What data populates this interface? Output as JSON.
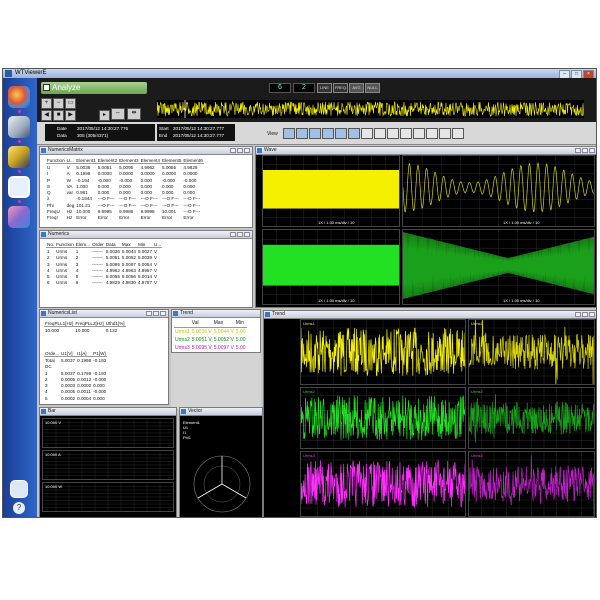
{
  "window": {
    "title": "WTViewerE"
  },
  "toolbar": {
    "analyze_label": "Analyze",
    "indicators": [
      "6",
      "2"
    ],
    "mode_labels": [
      "LINE",
      "FREQ",
      "AVG",
      "NULL"
    ]
  },
  "info": {
    "date_label": "Date",
    "data_label": "Data",
    "date_value": "2017/05/12 14:30:27.776",
    "data_value": "305 (305/4371)",
    "start_label": "Start",
    "end_label": "End",
    "start_value": "2017/05/12 14:30:27.777",
    "end_value": "2017/05/12 14:30:27.777",
    "view_label": "View"
  },
  "numerics_matrix": {
    "title": "NumericsMatrix",
    "headers": [
      "Function",
      "U...",
      "Element1",
      "Element2",
      "Element3",
      "Element4",
      "Element5",
      "Element6"
    ],
    "rows": [
      [
        "U",
        "V",
        "5.0036",
        "5.0051",
        "5.0095",
        "4.9962",
        "5.0055",
        "4.9829"
      ],
      [
        "I",
        "A",
        "0.1998",
        "0.0000",
        "0.0000",
        "0.0000",
        "0.0000",
        "0.0000"
      ],
      [
        "P",
        "W",
        "-0.194",
        "-0.000",
        "-0.000",
        "0.000",
        "-0.000",
        "-0.000"
      ],
      [
        "S",
        "VA",
        "1.000",
        "0.000",
        "0.000",
        "0.000",
        "0.000",
        "0.000"
      ],
      [
        "Q",
        "var",
        "0.981",
        "0.000",
        "0.000",
        "0.000",
        "0.000",
        "0.000"
      ],
      [
        "λ",
        "",
        "-0.1944",
        "---O F---",
        "---O F---",
        "---O F---",
        "---O F---",
        "---O F---"
      ],
      [
        "Phi",
        "deg",
        "101.21",
        "---O F---",
        "---O F---",
        "---O F---",
        "---O F---",
        "---O F---"
      ],
      [
        "FreqU",
        "Hz",
        "10.000",
        "9.9995",
        "9.9986",
        "9.9998",
        "10.001",
        "---O F---"
      ],
      [
        "FreqI",
        "Hz",
        "Error",
        "Error",
        "Error",
        "Error",
        "Error",
        "Error"
      ]
    ]
  },
  "numerics": {
    "title": "Numerics",
    "headers": [
      "No.",
      "Function",
      "Elem...",
      "Order",
      "Data",
      "Max",
      "Min",
      "U..."
    ],
    "rows": [
      [
        "1",
        "Urms",
        "1",
        "-------",
        "5.0036",
        "5.0044",
        "5.0027",
        "V"
      ],
      [
        "2",
        "Urms",
        "2",
        "-------",
        "5.0051",
        "5.0052",
        "5.0039",
        "V"
      ],
      [
        "3",
        "Urms",
        "3",
        "-------",
        "5.0095",
        "5.0097",
        "5.0054",
        "V"
      ],
      [
        "4",
        "Urms",
        "4",
        "-------",
        "4.9962",
        "4.9963",
        "4.9957",
        "V"
      ],
      [
        "5",
        "Urms",
        "5",
        "-------",
        "5.0055",
        "5.0056",
        "5.0014",
        "V"
      ],
      [
        "6",
        "Urms",
        "6",
        "-------",
        "4.9829",
        "4.9830",
        "4.9787",
        "V"
      ]
    ]
  },
  "numerics_list": {
    "title": "NumericsList",
    "headers": [
      "FreqPLL1[Hz]",
      "FreqPLL2[Hz]",
      "Uthd1[%]"
    ],
    "values": [
      "10.000",
      "10.000",
      "0.132"
    ],
    "order_headers": [
      "Orde...",
      "U1[V]",
      "I1[A]",
      "P1[W]"
    ],
    "rows": [
      [
        "Total",
        "5.0037",
        "0.1998",
        "-0.193"
      ],
      [
        "DC",
        "",
        "",
        ""
      ],
      [
        "1",
        "5.0037",
        "0.1799",
        "-0.193"
      ],
      [
        "2",
        "0.0005",
        "0.0012",
        "-0.000"
      ],
      [
        "3",
        "0.0003",
        "0.0000",
        "0.000"
      ],
      [
        "4",
        "0.0005",
        "0.0011",
        "-0.000"
      ],
      [
        "5",
        "0.0002",
        "0.0004",
        "0.000"
      ]
    ]
  },
  "bar": {
    "title": "Bar",
    "scales": [
      "10.000 V",
      "10.000 A",
      "10.000 W"
    ]
  },
  "vector": {
    "title": "Vector",
    "labels": [
      "Element1",
      "U1",
      "I1",
      "Phi1"
    ]
  },
  "wave": {
    "title": "Wave",
    "time_label": "1X / 1.00 ms/div / 10"
  },
  "trend": {
    "title": "Trend",
    "headers": [
      "",
      "Val",
      "Max",
      "Min"
    ],
    "rows": [
      [
        "Urms1",
        "5.0036 V",
        "5.0044 V",
        "5.00"
      ],
      [
        "Urms2",
        "5.0051 V",
        "5.0052 V",
        "5.00"
      ],
      [
        "Urms3",
        "5.0095 V",
        "5.0097 V",
        "5.00"
      ]
    ],
    "channel_labels": [
      "Urms1",
      "Urms2",
      "Urms3"
    ]
  },
  "colors": {
    "yellow": "#f5f000",
    "green": "#22e022",
    "magenta": "#ff30ff",
    "olive": "#d8d400",
    "darkgreen": "#1aa01a",
    "purple": "#c020c8"
  }
}
